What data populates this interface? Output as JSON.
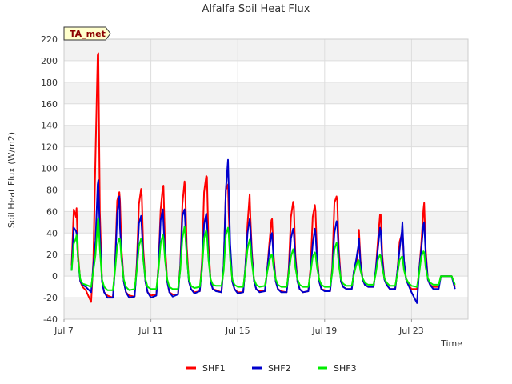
{
  "chart_data": {
    "type": "line",
    "title": "Alfalfa Soil Heat Flux",
    "xlabel": "Time",
    "ylabel": "Soil Heat Flux (W/m2)",
    "badge": "TA_met",
    "xlim": [
      7.0,
      25.6
    ],
    "ylim": [
      -40,
      220
    ],
    "yticks": [
      -40,
      -20,
      0,
      20,
      40,
      60,
      80,
      100,
      120,
      140,
      160,
      180,
      200,
      220
    ],
    "xticks": [
      {
        "value": 7,
        "label": "Jul 7"
      },
      {
        "value": 11,
        "label": "Jul 11"
      },
      {
        "value": 15,
        "label": "Jul 15"
      },
      {
        "value": 19,
        "label": "Jul 19"
      },
      {
        "value": 23,
        "label": "Jul 23"
      }
    ],
    "grid": true,
    "legend_position": "bottom-center",
    "x_range": [
      7.3,
      25.2
    ],
    "day_offsets": [
      0,
      0.25,
      0.35,
      0.45,
      0.55,
      0.58,
      0.65,
      0.75,
      0.85,
      1.0
    ],
    "days": [
      7,
      8,
      9,
      10,
      11,
      12,
      13,
      14,
      15,
      16,
      17,
      18,
      19,
      20,
      21,
      22,
      23,
      24,
      25
    ],
    "series": [
      {
        "name": "SHF1",
        "color": "#ff0000",
        "daily": [
          [
            -15,
            -22,
            10,
            62,
            55,
            63,
            20,
            -5,
            -10,
            -13
          ],
          [
            -13,
            -24,
            15,
            113,
            205,
            207,
            60,
            -5,
            -15,
            -18
          ],
          [
            -18,
            -20,
            10,
            70,
            78,
            70,
            25,
            -5,
            -15,
            -18
          ],
          [
            -18,
            -19,
            12,
            67,
            81,
            75,
            25,
            -5,
            -15,
            -18
          ],
          [
            -18,
            -17,
            10,
            62,
            83,
            84,
            30,
            -5,
            -15,
            -17
          ],
          [
            -17,
            -17,
            10,
            67,
            88,
            80,
            28,
            -5,
            -12,
            -15
          ],
          [
            -15,
            -14,
            12,
            78,
            93,
            92,
            30,
            -5,
            -12,
            -13
          ],
          [
            -13,
            -15,
            10,
            80,
            85,
            60,
            25,
            -5,
            -12,
            -15
          ],
          [
            -15,
            -15,
            8,
            48,
            76,
            55,
            22,
            -5,
            -12,
            -14
          ],
          [
            -14,
            -14,
            5,
            30,
            52,
            53,
            20,
            -5,
            -12,
            -14
          ],
          [
            -14,
            -15,
            8,
            55,
            69,
            65,
            20,
            -5,
            -12,
            -15
          ],
          [
            -15,
            -14,
            8,
            55,
            66,
            60,
            20,
            -5,
            -12,
            -13
          ],
          [
            -13,
            -14,
            8,
            68,
            74,
            70,
            25,
            -5,
            -10,
            -12
          ],
          [
            -12,
            -12,
            5,
            10,
            24,
            43,
            15,
            -3,
            -8,
            -10
          ],
          [
            -10,
            -10,
            5,
            32,
            57,
            57,
            20,
            -3,
            -8,
            -12
          ],
          [
            -12,
            -12,
            5,
            32,
            39,
            45,
            15,
            -3,
            -8,
            -12
          ],
          [
            -12,
            -12,
            5,
            30,
            62,
            68,
            25,
            -3,
            -8,
            -10
          ],
          [
            -10,
            -10,
            0,
            0,
            0,
            0,
            0,
            0,
            0,
            -10
          ],
          [
            -10,
            -10,
            0,
            0,
            0,
            0,
            0,
            0,
            0,
            -10
          ]
        ]
      },
      {
        "name": "SHF2",
        "color": "#0000cc",
        "daily": [
          [
            -18,
            -24,
            5,
            45,
            42,
            40,
            15,
            -5,
            -8,
            -10
          ],
          [
            -10,
            -15,
            10,
            33,
            85,
            89,
            40,
            -5,
            -15,
            -20
          ],
          [
            -20,
            -20,
            8,
            58,
            74,
            45,
            20,
            -5,
            -15,
            -20
          ],
          [
            -20,
            -19,
            8,
            49,
            56,
            45,
            18,
            -5,
            -15,
            -20
          ],
          [
            -20,
            -18,
            8,
            52,
            62,
            50,
            20,
            -5,
            -15,
            -19
          ],
          [
            -19,
            -17,
            8,
            56,
            62,
            50,
            20,
            -5,
            -12,
            -16
          ],
          [
            -16,
            -14,
            8,
            48,
            58,
            50,
            20,
            -5,
            -12,
            -14
          ],
          [
            -14,
            -15,
            10,
            80,
            108,
            85,
            30,
            -5,
            -12,
            -16
          ],
          [
            -16,
            -15,
            8,
            40,
            53,
            45,
            18,
            -5,
            -12,
            -15
          ],
          [
            -15,
            -14,
            5,
            25,
            39,
            40,
            15,
            -5,
            -12,
            -15
          ],
          [
            -15,
            -15,
            5,
            35,
            44,
            40,
            15,
            -5,
            -12,
            -15
          ],
          [
            -15,
            -14,
            5,
            30,
            44,
            40,
            15,
            -5,
            -12,
            -14
          ],
          [
            -14,
            -14,
            5,
            40,
            51,
            50,
            18,
            -5,
            -10,
            -12
          ],
          [
            -12,
            -12,
            5,
            15,
            28,
            35,
            12,
            -3,
            -8,
            -10
          ],
          [
            -10,
            -10,
            5,
            25,
            45,
            42,
            15,
            -3,
            -8,
            -12
          ],
          [
            -12,
            -12,
            5,
            25,
            41,
            50,
            15,
            -3,
            -8,
            -15
          ],
          [
            -15,
            -25,
            5,
            25,
            48,
            50,
            20,
            -3,
            -8,
            -12
          ],
          [
            -12,
            -12,
            0,
            0,
            0,
            0,
            0,
            0,
            0,
            -12
          ],
          [
            -12,
            -12,
            0,
            0,
            0,
            0,
            0,
            0,
            0,
            -12
          ]
        ]
      },
      {
        "name": "SHF3",
        "color": "#00ee00",
        "daily": [
          [
            -10,
            -13,
            5,
            30,
            35,
            38,
            15,
            -3,
            -7,
            -8
          ],
          [
            -8,
            -10,
            5,
            20,
            50,
            54,
            25,
            -3,
            -10,
            -13
          ],
          [
            -13,
            -13,
            5,
            28,
            35,
            34,
            15,
            -3,
            -10,
            -13
          ],
          [
            -13,
            -12,
            5,
            28,
            35,
            32,
            15,
            -3,
            -10,
            -12
          ],
          [
            -12,
            -12,
            5,
            30,
            38,
            35,
            15,
            -3,
            -10,
            -12
          ],
          [
            -12,
            -12,
            5,
            35,
            46,
            40,
            18,
            -3,
            -9,
            -11
          ],
          [
            -11,
            -10,
            5,
            35,
            43,
            38,
            15,
            -3,
            -8,
            -9
          ],
          [
            -9,
            -9,
            5,
            38,
            45,
            40,
            15,
            -3,
            -8,
            -10
          ],
          [
            -10,
            -10,
            5,
            25,
            34,
            30,
            12,
            -3,
            -8,
            -10
          ],
          [
            -10,
            -9,
            3,
            14,
            20,
            20,
            8,
            -3,
            -8,
            -10
          ],
          [
            -10,
            -10,
            3,
            18,
            25,
            22,
            8,
            -3,
            -8,
            -10
          ],
          [
            -10,
            -10,
            3,
            18,
            22,
            20,
            8,
            -3,
            -8,
            -10
          ],
          [
            -10,
            -10,
            3,
            25,
            31,
            28,
            10,
            -3,
            -7,
            -9
          ],
          [
            -9,
            -9,
            2,
            10,
            15,
            14,
            5,
            -2,
            -6,
            -8
          ],
          [
            -8,
            -8,
            2,
            15,
            20,
            18,
            8,
            -2,
            -6,
            -9
          ],
          [
            -9,
            -9,
            2,
            15,
            18,
            18,
            6,
            -2,
            -6,
            -9
          ],
          [
            -9,
            -10,
            2,
            18,
            23,
            22,
            8,
            -2,
            -6,
            -8
          ],
          [
            -8,
            -8,
            0,
            0,
            0,
            0,
            0,
            0,
            0,
            -8
          ],
          [
            -8,
            -8,
            0,
            0,
            0,
            0,
            0,
            0,
            0,
            -8
          ]
        ]
      }
    ]
  }
}
